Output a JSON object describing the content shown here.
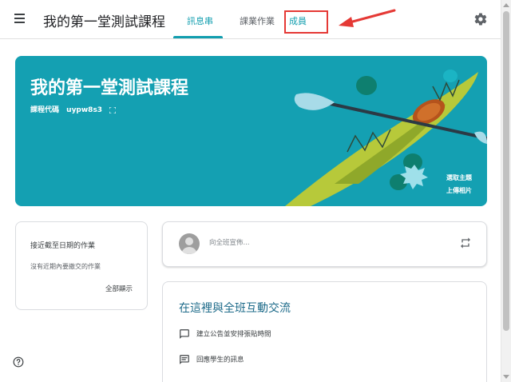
{
  "header": {
    "course_title": "我的第一堂測試課程",
    "tabs": [
      {
        "label": "訊息串",
        "active": true
      },
      {
        "label": "課業作業",
        "active": false
      },
      {
        "label": "成員",
        "active": false
      }
    ]
  },
  "banner": {
    "title": "我的第一堂測試課程",
    "code_label": "課程代碼",
    "code_value": "uypw8s3",
    "select_theme": "選取主題",
    "upload_photo": "上傳相片",
    "color": "#14a0b2"
  },
  "upcoming": {
    "title": "接近截至日期的作業",
    "empty_text": "沒有近期內要繳交的作業",
    "view_all": "全部顯示"
  },
  "announce": {
    "placeholder": "向全班宣佈..."
  },
  "communicate": {
    "title": "在這裡與全班互動交流",
    "items": [
      {
        "label": "建立公告並安排張貼時間",
        "icon": "announcement-icon"
      },
      {
        "label": "回應學生的訊息",
        "icon": "message-icon"
      }
    ]
  },
  "colors": {
    "accent": "#129eaf",
    "highlight_box": "#e53935"
  }
}
